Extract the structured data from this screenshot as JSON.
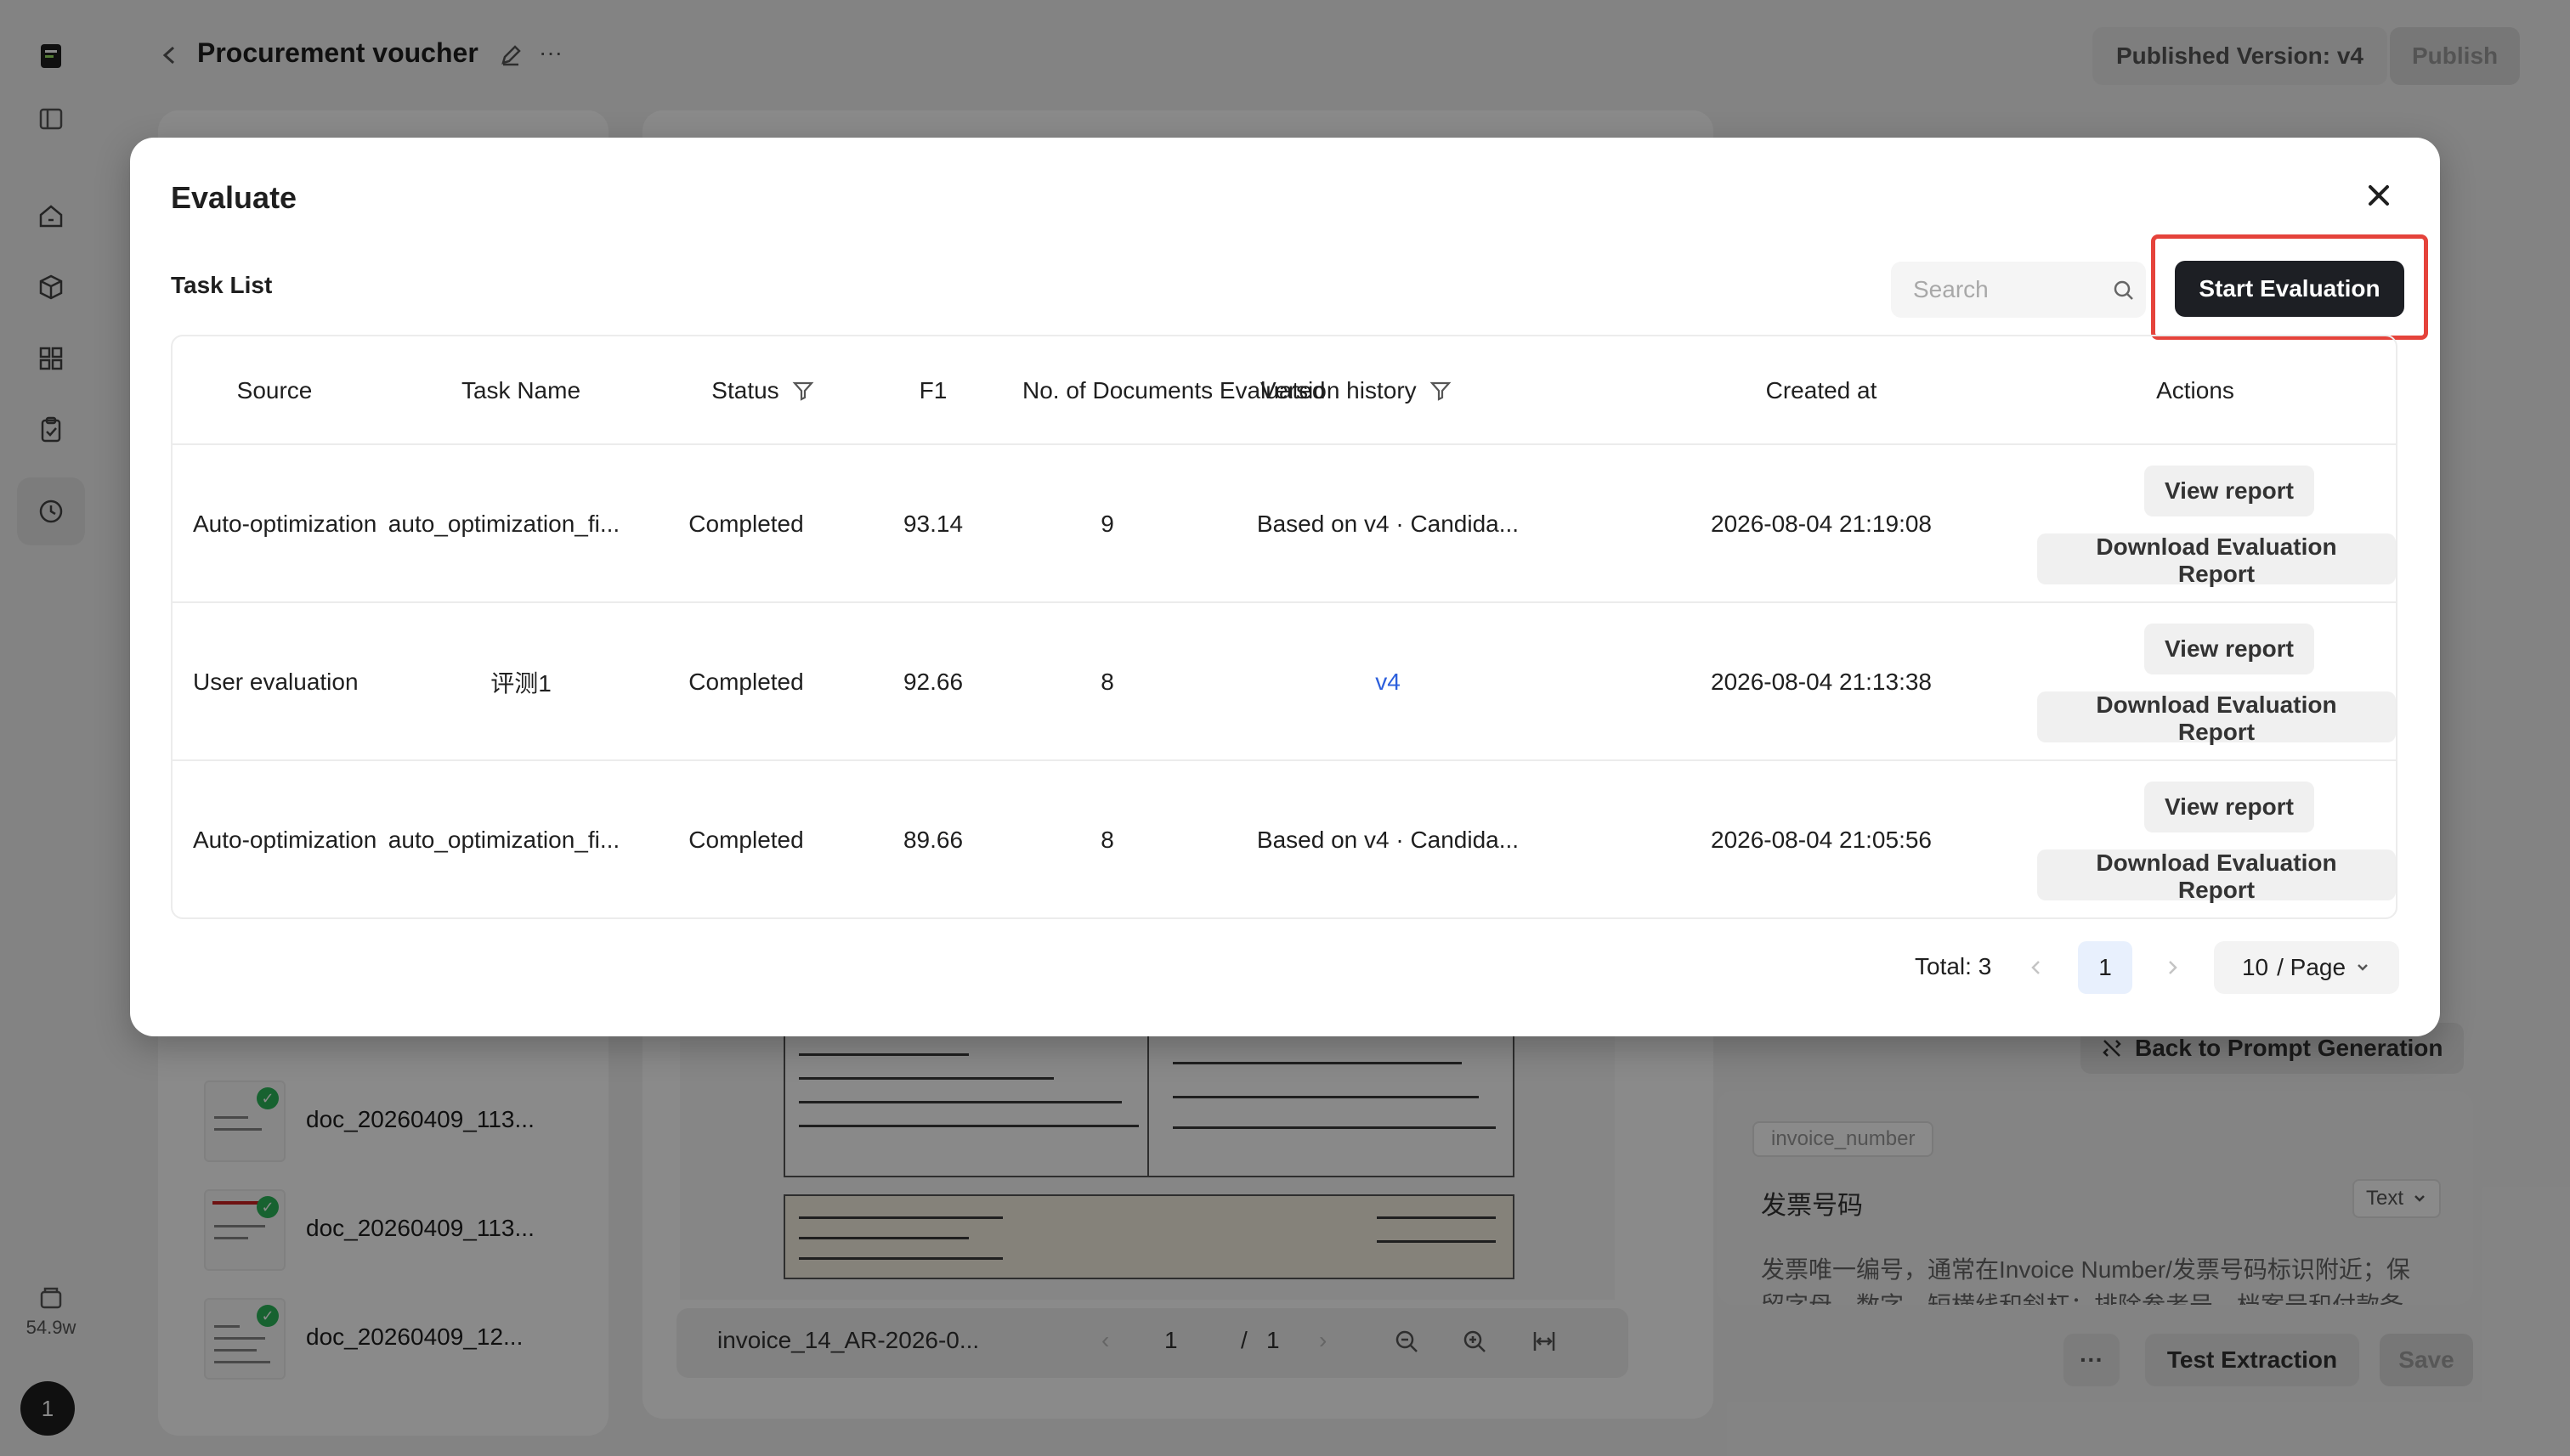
{
  "header": {
    "title": "Procurement voucher",
    "published_version": "Published Version: v4",
    "publish_label": "Publish"
  },
  "sidebar": {
    "storage": "54.9w",
    "avatar": "1"
  },
  "documents": [
    {
      "name": "doc_20260409_113..."
    },
    {
      "name": "doc_20260409_113..."
    },
    {
      "name": "doc_20260409_12..."
    }
  ],
  "viewer": {
    "file_name": "invoice_14_AR-2026-0...",
    "page_current": "1",
    "page_separator": "/",
    "page_total": "1"
  },
  "editor": {
    "back_to_prompt": "Back to Prompt Generation",
    "field_key": "invoice_number",
    "field_label": "发票号码",
    "field_type": "Text",
    "field_description": "发票唯一编号，通常在Invoice Number/发票号码标识附近；保留字母、数字、短横线和斜杠；排除参考号、档案号和付款备",
    "more_label": "···",
    "test_extraction": "Test Extraction",
    "save": "Save"
  },
  "modal": {
    "title": "Evaluate",
    "task_list_label": "Task List",
    "search_placeholder": "Search",
    "start_button": "Start Evaluation",
    "columns": [
      "Source",
      "Task Name",
      "Status",
      "F1",
      "No. of Documents Evaluated",
      "Version history",
      "Created at",
      "Actions"
    ],
    "rows": [
      {
        "source": "Auto-optimization",
        "task_name": "auto_optimization_fi...",
        "status": "Completed",
        "f1": "93.14",
        "docs": "9",
        "version": "Based on v4 · Candida...",
        "created_at": "2026-08-04 21:19:08",
        "view_label": "View report",
        "download_label": "Download Evaluation Report"
      },
      {
        "source": "User evaluation",
        "task_name": "评测1",
        "status": "Completed",
        "f1": "92.66",
        "docs": "8",
        "version": "v4",
        "created_at": "2026-08-04 21:13:38",
        "view_label": "View report",
        "download_label": "Download Evaluation Report"
      },
      {
        "source": "Auto-optimization",
        "task_name": "auto_optimization_fi...",
        "status": "Completed",
        "f1": "89.66",
        "docs": "8",
        "version": "Based on v4 · Candida...",
        "created_at": "2026-08-04 21:05:56",
        "view_label": "View report",
        "download_label": "Download Evaluation Report"
      }
    ],
    "pagination": {
      "total": "Total: 3",
      "current_page": "1",
      "page_size": "10",
      "page_size_suffix": "/ Page"
    }
  },
  "colors": {
    "primary_dark": "#1d1f24",
    "highlight": "#e5433b",
    "link": "#2c5fdc",
    "success": "#2bb55a"
  }
}
